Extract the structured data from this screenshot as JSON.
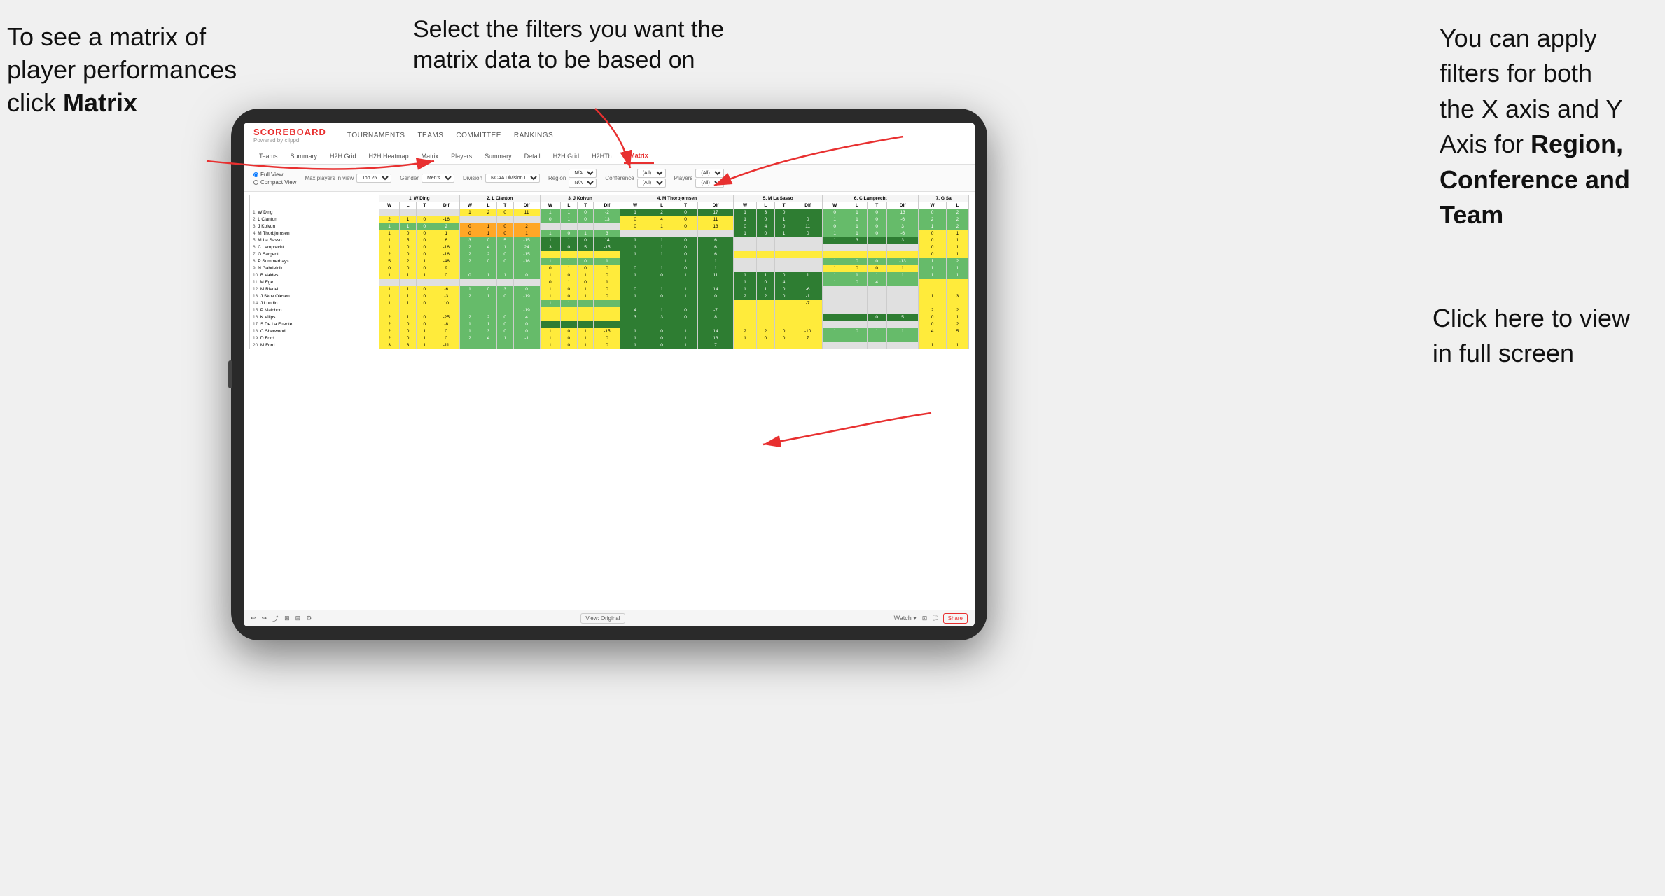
{
  "annotations": {
    "top_left": {
      "line1": "To see a matrix of",
      "line2": "player performances",
      "line3_prefix": "click ",
      "line3_bold": "Matrix"
    },
    "top_center": "Select the filters you want the matrix data to be based on",
    "top_right": {
      "line1": "You  can apply",
      "line2": "filters for both",
      "line3": "the X axis and Y",
      "line4_prefix": "Axis for ",
      "line4_bold": "Region,",
      "line5_bold": "Conference and",
      "line6_bold": "Team"
    },
    "bottom_right": {
      "line1": "Click here to view",
      "line2": "in full screen"
    }
  },
  "scoreboard": {
    "title": "SCOREBOARD",
    "subtitle": "Powered by clippd"
  },
  "nav": {
    "items": [
      "TOURNAMENTS",
      "TEAMS",
      "COMMITTEE",
      "RANKINGS"
    ]
  },
  "sub_nav": {
    "items": [
      "Teams",
      "Summary",
      "H2H Grid",
      "H2H Heatmap",
      "Matrix",
      "Players",
      "Summary",
      "Detail",
      "H2H Grid",
      "H2HTH...",
      "Matrix"
    ],
    "active": "Matrix"
  },
  "filters": {
    "view_options": [
      "Full View",
      "Compact View"
    ],
    "max_players_label": "Max players in view",
    "max_players_value": "Top 25",
    "gender_label": "Gender",
    "gender_value": "Men's",
    "division_label": "Division",
    "division_value": "NCAA Division I",
    "region_label": "Region",
    "region_values": [
      "N/A",
      "N/A"
    ],
    "conference_label": "Conference",
    "conference_values": [
      "(All)",
      "(All)"
    ],
    "players_label": "Players",
    "players_values": [
      "(All)",
      "(All)"
    ]
  },
  "matrix": {
    "col_headers": [
      "1. W Ding",
      "2. L Clanton",
      "3. J Koivun",
      "4. M Thorbjornsen",
      "5. M La Sasso",
      "6. C Lamprecht",
      "7. G Sa"
    ],
    "sub_headers": [
      "W",
      "L",
      "T",
      "Dif"
    ],
    "rows": [
      {
        "num": "1.",
        "name": "W Ding"
      },
      {
        "num": "2.",
        "name": "L Clanton"
      },
      {
        "num": "3.",
        "name": "J Koivun"
      },
      {
        "num": "4.",
        "name": "M Thorbjornsen"
      },
      {
        "num": "5.",
        "name": "M La Sasso"
      },
      {
        "num": "6.",
        "name": "C Lamprecht"
      },
      {
        "num": "7.",
        "name": "G Sargent"
      },
      {
        "num": "8.",
        "name": "P Summerhays"
      },
      {
        "num": "9.",
        "name": "N Gabrielcik"
      },
      {
        "num": "10.",
        "name": "B Valdes"
      },
      {
        "num": "11.",
        "name": "M Ege"
      },
      {
        "num": "12.",
        "name": "M Riedel"
      },
      {
        "num": "13.",
        "name": "J Skov Olesen"
      },
      {
        "num": "14.",
        "name": "J Lundin"
      },
      {
        "num": "15.",
        "name": "P Maichon"
      },
      {
        "num": "16.",
        "name": "K Vilips"
      },
      {
        "num": "17.",
        "name": "S De La Fuente"
      },
      {
        "num": "18.",
        "name": "C Sherwood"
      },
      {
        "num": "19.",
        "name": "D Ford"
      },
      {
        "num": "20.",
        "name": "M Ford"
      }
    ]
  },
  "toolbar": {
    "view_original": "View: Original",
    "watch": "Watch ▾",
    "share": "Share"
  }
}
